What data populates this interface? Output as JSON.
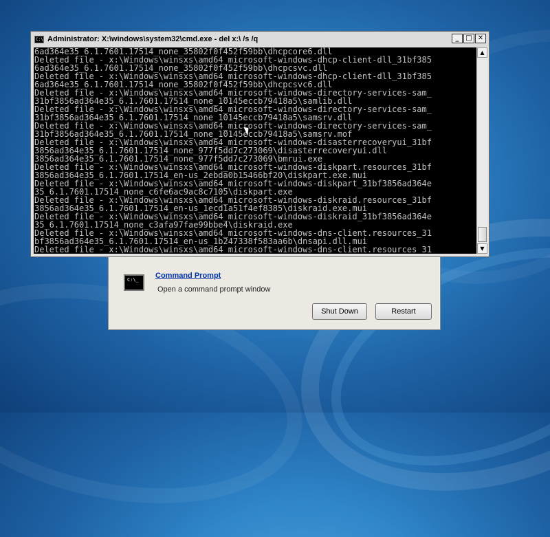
{
  "recovery": {
    "command_prompt_title": "Command Prompt",
    "command_prompt_desc": "Open a command prompt window",
    "shutdown_label": "Shut Down",
    "restart_label": "Restart"
  },
  "cmd": {
    "title": "Administrator: X:\\windows\\system32\\cmd.exe - del x:\\ /s /q",
    "icon_text": "C:\\",
    "minimize": "_",
    "maximize": "□",
    "close": "✕",
    "lines": [
      "6ad364e35_6.1.7601.17514_none_35802f0f452f59bb\\dhcpcore6.dll",
      "Deleted file - x:\\Windows\\winsxs\\amd64_microsoft-windows-dhcp-client-dll_31bf385",
      "6ad364e35_6.1.7601.17514_none_35802f0f452f59bb\\dhcpcsvc.dll",
      "Deleted file - x:\\Windows\\winsxs\\amd64_microsoft-windows-dhcp-client-dll_31bf385",
      "6ad364e35_6.1.7601.17514_none_35802f0f452f59bb\\dhcpcsvc6.dll",
      "Deleted file - x:\\Windows\\winsxs\\amd64_microsoft-windows-directory-services-sam_",
      "31bf3856ad364e35_6.1.7601.17514_none_10145eccb79418a5\\samlib.dll",
      "Deleted file - x:\\Windows\\winsxs\\amd64_microsoft-windows-directory-services-sam_",
      "31bf3856ad364e35_6.1.7601.17514_none_10145eccb79418a5\\samsrv.dll",
      "Deleted file - x:\\Windows\\winsxs\\amd64_microsoft-windows-directory-services-sam_",
      "31bf3856ad364e35_6.1.7601.17514_none_10145eccb79418a5\\samsrv.mof",
      "Deleted file - x:\\Windows\\winsxs\\amd64_microsoft-windows-disasterrecoveryui_31bf",
      "3856ad364e35_6.1.7601.17514_none_977f5dd7c273069\\disasterrecoveryui.dll",
      "3856ad364e35_6.1.7601.17514_none_977f5dd7c273069\\bmrui.exe",
      "Deleted file - x:\\Windows\\winsxs\\amd64_microsoft-windows-diskpart.resources_31bf",
      "3856ad364e35_6.1.7601.17514_en-us_2ebda0b15466bf20\\diskpart.exe.mui",
      "Deleted file - x:\\Windows\\winsxs\\amd64_microsoft-windows-diskpart_31bf3856ad364e",
      "35_6.1.7601.17514_none_c6fe6ac9ac8c7105\\diskpart.exe",
      "Deleted file - x:\\Windows\\winsxs\\amd64_microsoft-windows-diskraid.resources_31bf",
      "3856ad364e35_6.1.7601.17514_en-us_1ecd1a51f4ef8385\\diskraid.exe.mui",
      "Deleted file - x:\\Windows\\winsxs\\amd64_microsoft-windows-diskraid_31bf3856ad364e",
      "35_6.1.7601.17514_none_c3afa97fae99bbe4\\diskraid.exe",
      "Deleted file - x:\\Windows\\winsxs\\amd64_microsoft-windows-dns-client.resources_31",
      "bf3856ad364e35_6.1.7601.17514_en-us_1b247338f583aa6b\\dnsapi.dll.mui",
      "Deleted file - x:\\Windows\\winsxs\\amd64_microsoft-windows-dns-client.resources_31"
    ]
  }
}
